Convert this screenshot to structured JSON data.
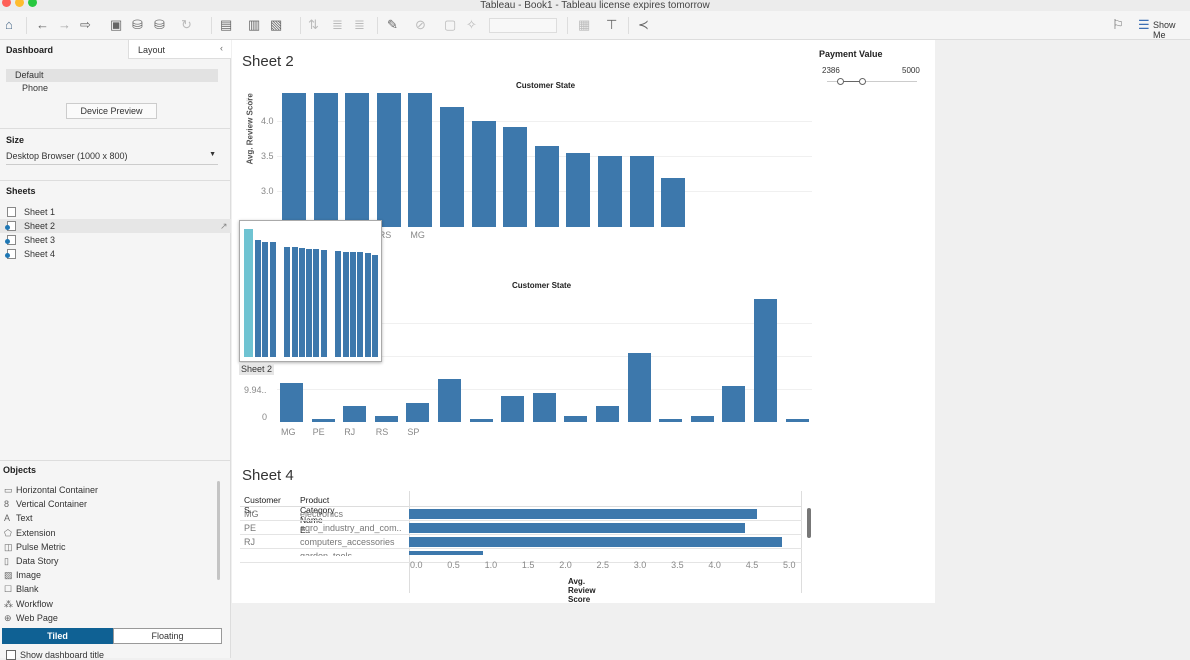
{
  "window": {
    "title": "Tableau - Book1 - Tableau license expires tomorrow"
  },
  "toolbar": {
    "show_me": "Show Me"
  },
  "left_panel": {
    "tabs": {
      "dashboard": "Dashboard",
      "layout": "Layout"
    },
    "devices": [
      "Default",
      "Phone"
    ],
    "device_preview": "Device Preview",
    "size_label": "Size",
    "size_value": "Desktop Browser (1000 x 800)",
    "sheets_label": "Sheets",
    "sheets": [
      "Sheet 1",
      "Sheet 2",
      "Sheet 3",
      "Sheet 4"
    ],
    "objects_label": "Objects",
    "objects": [
      {
        "icon": "▭",
        "label": "Horizontal Container"
      },
      {
        "icon": "8",
        "label": "Vertical Container"
      },
      {
        "icon": "A",
        "label": "Text"
      },
      {
        "icon": "⬠",
        "label": "Extension"
      },
      {
        "icon": "◫",
        "label": "Pulse Metric"
      },
      {
        "icon": "▯",
        "label": "Data Story"
      },
      {
        "icon": "▨",
        "label": "Image"
      },
      {
        "icon": "☐",
        "label": "Blank"
      },
      {
        "icon": "⁂",
        "label": "Workflow"
      },
      {
        "icon": "⊕",
        "label": "Web Page"
      }
    ],
    "tiled": "Tiled",
    "floating": "Floating",
    "show_title": "Show dashboard title"
  },
  "filter": {
    "title": "Payment Value",
    "min": "2386",
    "max": "5000"
  },
  "drag": {
    "label": "Sheet 2"
  },
  "chart_data": [
    {
      "type": "bar",
      "name": "Sheet 2",
      "title": "Customer State",
      "ylabel": "Avg. Review Score",
      "ylim": [
        2.5,
        4.45
      ],
      "yticks": [
        "4.0",
        "3.5",
        "3.0"
      ],
      "ytick_values": [
        4.0,
        3.5,
        3.0
      ],
      "categories": [
        "",
        "",
        "",
        "RS",
        "MG",
        "",
        "",
        "",
        "",
        "",
        "",
        "",
        ""
      ],
      "values": [
        4.4,
        4.4,
        4.4,
        4.4,
        4.4,
        4.2,
        4.0,
        3.92,
        3.65,
        3.54,
        3.5,
        3.5,
        3.19
      ]
    },
    {
      "type": "bar",
      "name": "Sheet 3",
      "title": "Customer State",
      "ylim": [
        0,
        40
      ],
      "yticks": [
        "9.94..",
        "0"
      ],
      "ytick_values": [
        9.94,
        0
      ],
      "categories": [
        "MG",
        "PE",
        "RJ",
        "RS",
        "SP",
        "",
        "",
        "",
        "",
        "",
        "",
        "",
        "",
        "",
        "",
        "",
        ""
      ],
      "values": [
        11.7,
        1,
        4.8,
        1.8,
        5.7,
        12.9,
        1,
        7.8,
        8.7,
        1.8,
        4.8,
        20.8,
        1,
        1.8,
        10.8,
        37,
        1
      ]
    },
    {
      "type": "bar",
      "name": "Sheet 4",
      "title": "Sheet 4",
      "xlabel": "Avg. Review Score",
      "columns": [
        "Customer S..",
        "Product Category Name E.."
      ],
      "rows": [
        {
          "state": "MG",
          "category": "electronics",
          "value": 4.66
        },
        {
          "state": "PE",
          "category": "agro_industry_and_com..",
          "value": 4.5
        },
        {
          "state": "RJ",
          "category": "computers_accessories",
          "value": 5.0
        },
        {
          "state": "",
          "category": "garden_tools",
          "value": 0.99
        }
      ],
      "xticks": [
        "0.0",
        "0.5",
        "1.0",
        "1.5",
        "2.0",
        "2.5",
        "3.0",
        "3.5",
        "4.0",
        "4.5",
        "5.0"
      ],
      "xlim": [
        0,
        5
      ]
    }
  ]
}
